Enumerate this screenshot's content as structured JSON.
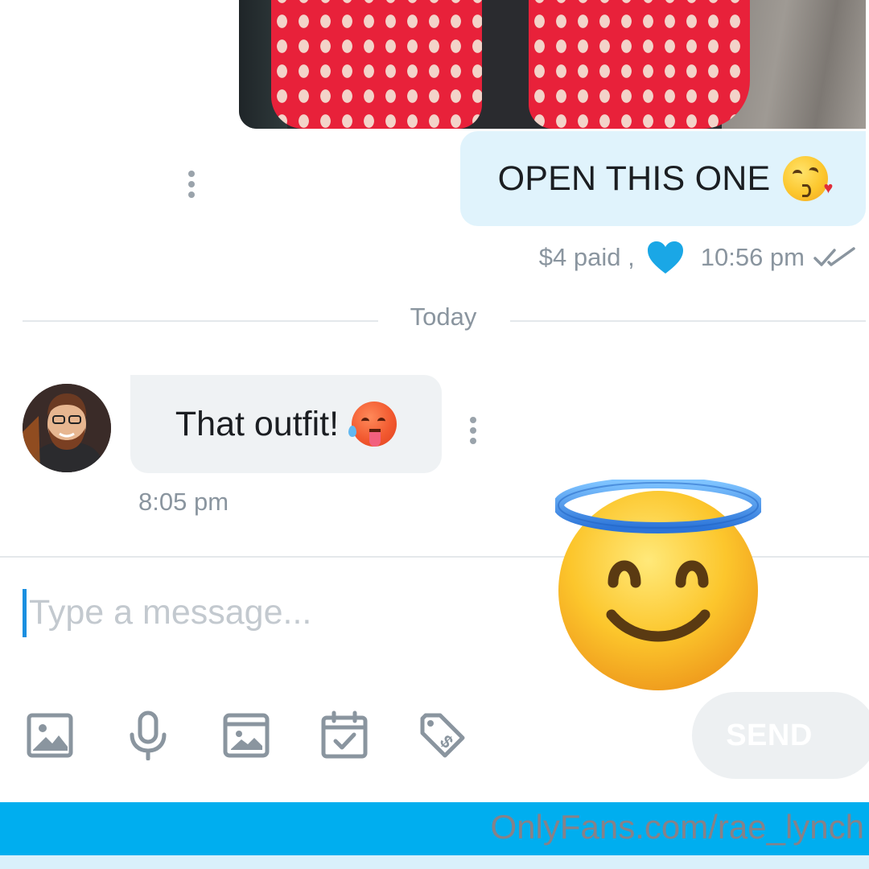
{
  "conversation": {
    "outgoing": {
      "text": "OPEN THIS ONE",
      "emoji": "face-blowing-a-kiss",
      "price": "$4 paid ,",
      "heart_icon": "heart-icon",
      "time": "10:56 pm",
      "status_icon": "double-check-icon"
    },
    "divider": "Today",
    "incoming": {
      "text": "That outfit!",
      "emoji": "hot-face",
      "time": "8:05 pm"
    }
  },
  "composer": {
    "placeholder": "Type a message...",
    "value": "",
    "tools": [
      "image-icon",
      "microphone-icon",
      "media-vault-icon",
      "schedule-icon",
      "price-tag-icon"
    ],
    "send_label": "SEND"
  },
  "overlay": {
    "emoji": "smiling-face-with-halo"
  },
  "watermark": "OnlyFans.com/rae_lynch",
  "colors": {
    "accent": "#00aeef",
    "outgoing_bubble": "#e0f3fc",
    "incoming_bubble": "#eff2f4",
    "meta_text": "#8a959f",
    "heart": "#1aa7e6"
  }
}
